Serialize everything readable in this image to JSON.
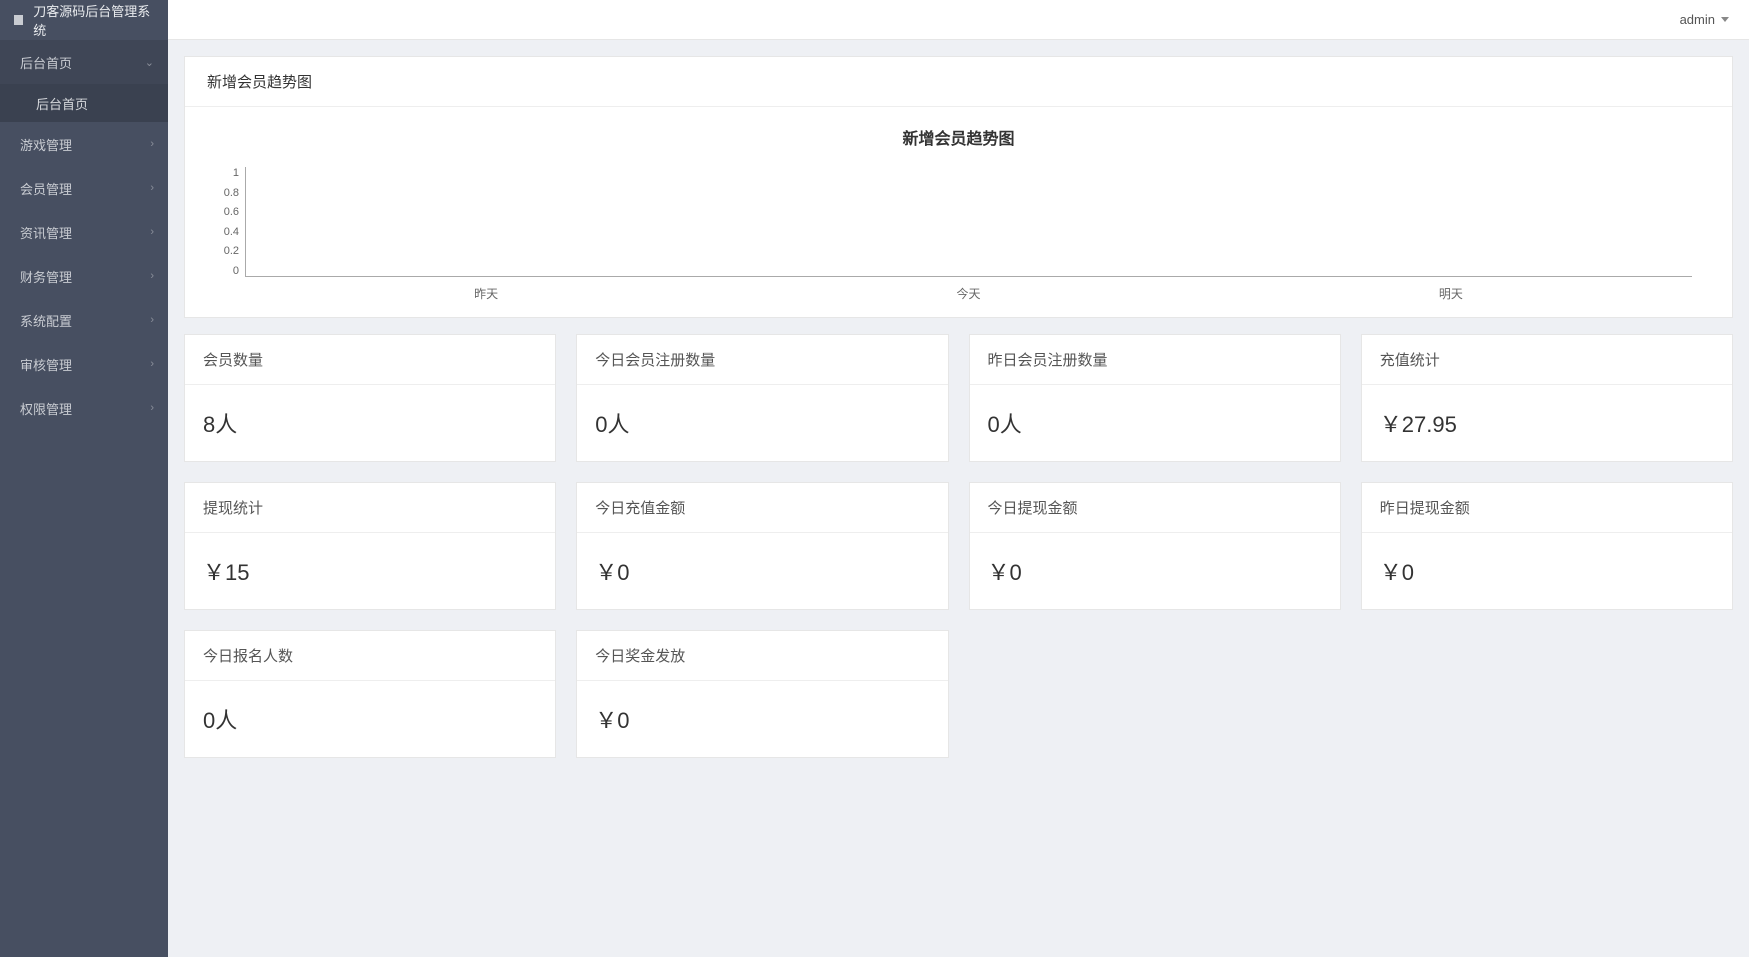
{
  "brand": "刀客源码后台管理系统",
  "user": {
    "name": "admin"
  },
  "nav": {
    "items": [
      {
        "label": "后台首页",
        "expanded": true,
        "sub": [
          {
            "label": "后台首页"
          }
        ]
      },
      {
        "label": "游戏管理"
      },
      {
        "label": "会员管理"
      },
      {
        "label": "资讯管理"
      },
      {
        "label": "财务管理"
      },
      {
        "label": "系统配置"
      },
      {
        "label": "审核管理"
      },
      {
        "label": "权限管理"
      }
    ]
  },
  "chart_panel": {
    "title": "新增会员趋势图"
  },
  "chart_data": {
    "type": "line",
    "title": "新增会员趋势图",
    "categories": [
      "昨天",
      "今天",
      "明天"
    ],
    "values": [
      0,
      0,
      0
    ],
    "ylim": [
      0,
      1
    ],
    "yticks": [
      "1",
      "0.8",
      "0.6",
      "0.4",
      "0.2",
      "0"
    ],
    "xlabel": "",
    "ylabel": ""
  },
  "cards": [
    {
      "title": "会员数量",
      "value": "8人"
    },
    {
      "title": "今日会员注册数量",
      "value": "0人"
    },
    {
      "title": "昨日会员注册数量",
      "value": "0人"
    },
    {
      "title": "充值统计",
      "value": "￥27.95"
    },
    {
      "title": "提现统计",
      "value": "￥15"
    },
    {
      "title": "今日充值金额",
      "value": "￥0"
    },
    {
      "title": "今日提现金额",
      "value": "￥0"
    },
    {
      "title": "昨日提现金额",
      "value": "￥0"
    },
    {
      "title": "今日报名人数",
      "value": "0人"
    },
    {
      "title": "今日奖金发放",
      "value": "￥0"
    }
  ]
}
